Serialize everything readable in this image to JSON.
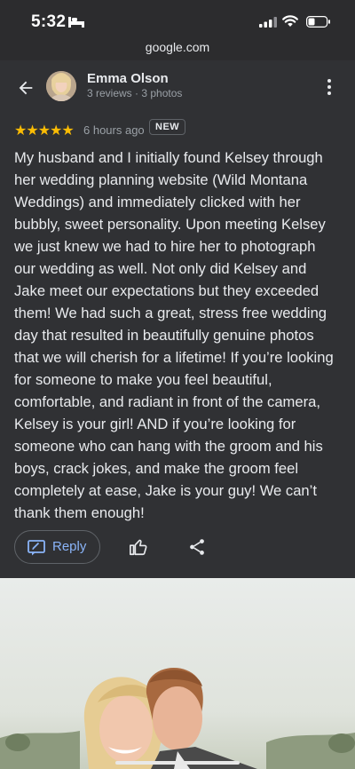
{
  "status_bar": {
    "time": "5:32"
  },
  "browser": {
    "url": "google.com"
  },
  "reviewer": {
    "name": "Emma Olson",
    "meta": "3 reviews · 3 photos"
  },
  "rating": {
    "stars": 5,
    "stars_text": "★★★★★",
    "time_ago": "6 hours ago",
    "badge": "NEW"
  },
  "review_lines": [
    "My husband and I initially found Kelsey through",
    "her wedding planning website (Wild Montana",
    "Weddings) and immediately clicked with her",
    "bubbly, sweet personality. Upon meeting Kelsey",
    "we just knew we had to hire her to photograph",
    "our wedding as well. Not only did Kelsey and",
    "Jake meet our expectations but they exceeded",
    "them! We had such a great, stress free wedding",
    "day that resulted in beautifully genuine photos",
    "that we will cherish for a lifetime! If you’re looking",
    "for someone to make you feel beautiful,",
    "comfortable, and radiant in front of the camera,",
    "Kelsey is your girl! AND if you’re looking for",
    "someone who can hang with the groom and his",
    "boys, crack jokes, and make the groom feel",
    "completely at ease, Jake is your guy! We can’t",
    "thank them enough!"
  ],
  "actions": {
    "reply_label": "Reply"
  },
  "icons": {
    "back": "arrow-left-icon",
    "more": "more-vert-icon",
    "reply": "reply-icon",
    "like": "thumbs-up-icon",
    "share": "share-icon"
  },
  "colors": {
    "background": "#303134",
    "accent": "#8ab4f8",
    "star": "#fbbc04"
  }
}
